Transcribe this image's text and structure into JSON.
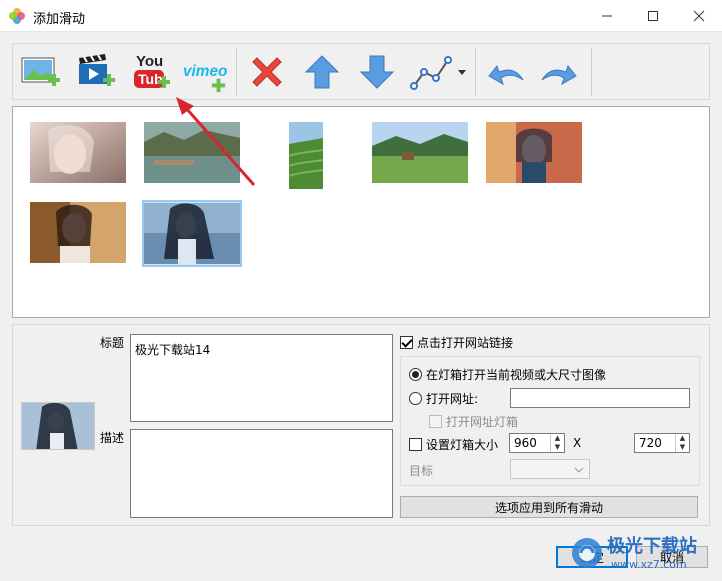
{
  "window": {
    "title": "添加滑动"
  },
  "toolbar": {
    "vimeo_text": "vimeo",
    "youtube_text": "You"
  },
  "fields": {
    "title_label": "标题",
    "title_value": "极光下载站14",
    "desc_label": "描述",
    "desc_value": ""
  },
  "options": {
    "open_link_label": "点击打开网站链接",
    "open_link_checked": true,
    "lightbox_label": "在灯箱打开当前视频或大尺寸图像",
    "open_url_label": "打开网址:",
    "open_url_value": "",
    "open_url_lightbox_label": "打开网址灯箱",
    "set_size_label": "设置灯箱大小",
    "width_value": "960",
    "x_label": "X",
    "height_value": "720",
    "target_label": "目标",
    "apply_all_label": "选项应用到所有滑动"
  },
  "buttons": {
    "ok_label": "确定",
    "cancel_label": "取消"
  },
  "watermark": {
    "brand": "极光下载站",
    "url": "www.xz7.com"
  },
  "colors": {
    "accent": "#0078d7",
    "delete_red": "#e8473b",
    "arrow_blue": "#4a90d9",
    "annotation_red": "#d9262c",
    "selection": "#cce4fa"
  }
}
